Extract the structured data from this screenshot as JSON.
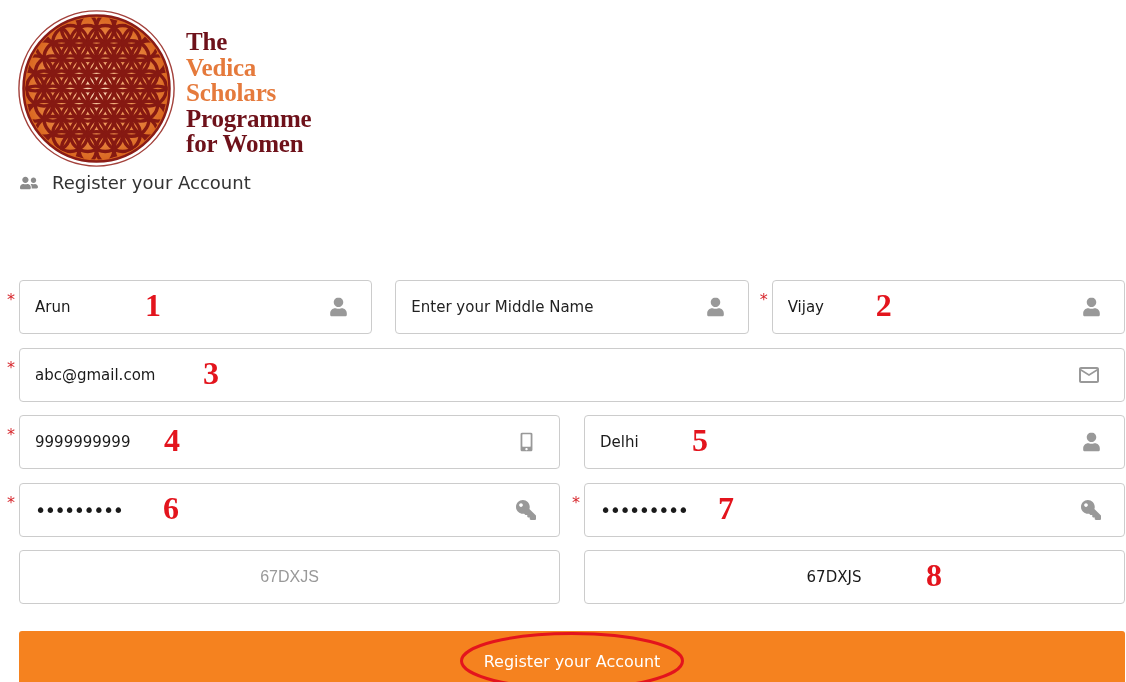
{
  "logo": {
    "lines": [
      {
        "text": "The",
        "kind": "dark"
      },
      {
        "text": "Vedica",
        "kind": "accent"
      },
      {
        "text": "Scholars",
        "kind": "accent"
      },
      {
        "text": "Programme",
        "kind": "dark"
      },
      {
        "text": "for Women",
        "kind": "dark"
      }
    ]
  },
  "heading": {
    "title": "Register your Account"
  },
  "form": {
    "rows": [
      {
        "fields": [
          {
            "kind": "name",
            "marker": "*",
            "value": "Arun",
            "annotation": "1"
          },
          {
            "kind": "name",
            "placeholder": "Enter your Middle Name"
          },
          {
            "kind": "name",
            "marker": "*",
            "value": "Vijay",
            "annotation": "2"
          }
        ]
      },
      {
        "fields": [
          {
            "kind": "email",
            "marker": "*",
            "value": "abc@gmail.com",
            "annotation": "3"
          }
        ]
      },
      {
        "fields": [
          {
            "kind": "phone",
            "marker": "*",
            "value": "9999999999",
            "annotation": "4"
          },
          {
            "kind": "city",
            "value": "Delhi",
            "annotation": "5"
          }
        ]
      },
      {
        "fields": [
          {
            "kind": "password",
            "marker": "*",
            "value": "•••••••••",
            "annotation": "6"
          },
          {
            "kind": "password",
            "marker": "*",
            "value": "•••••••••",
            "annotation": "7"
          }
        ]
      },
      {
        "fields": [
          {
            "kind": "captcha",
            "value": "67DXJS"
          },
          {
            "kind": "captcha_input",
            "value": "67DXJS",
            "annotation": "8"
          }
        ]
      }
    ]
  },
  "submit_button": {
    "label": "Register your Account",
    "circled": true
  }
}
